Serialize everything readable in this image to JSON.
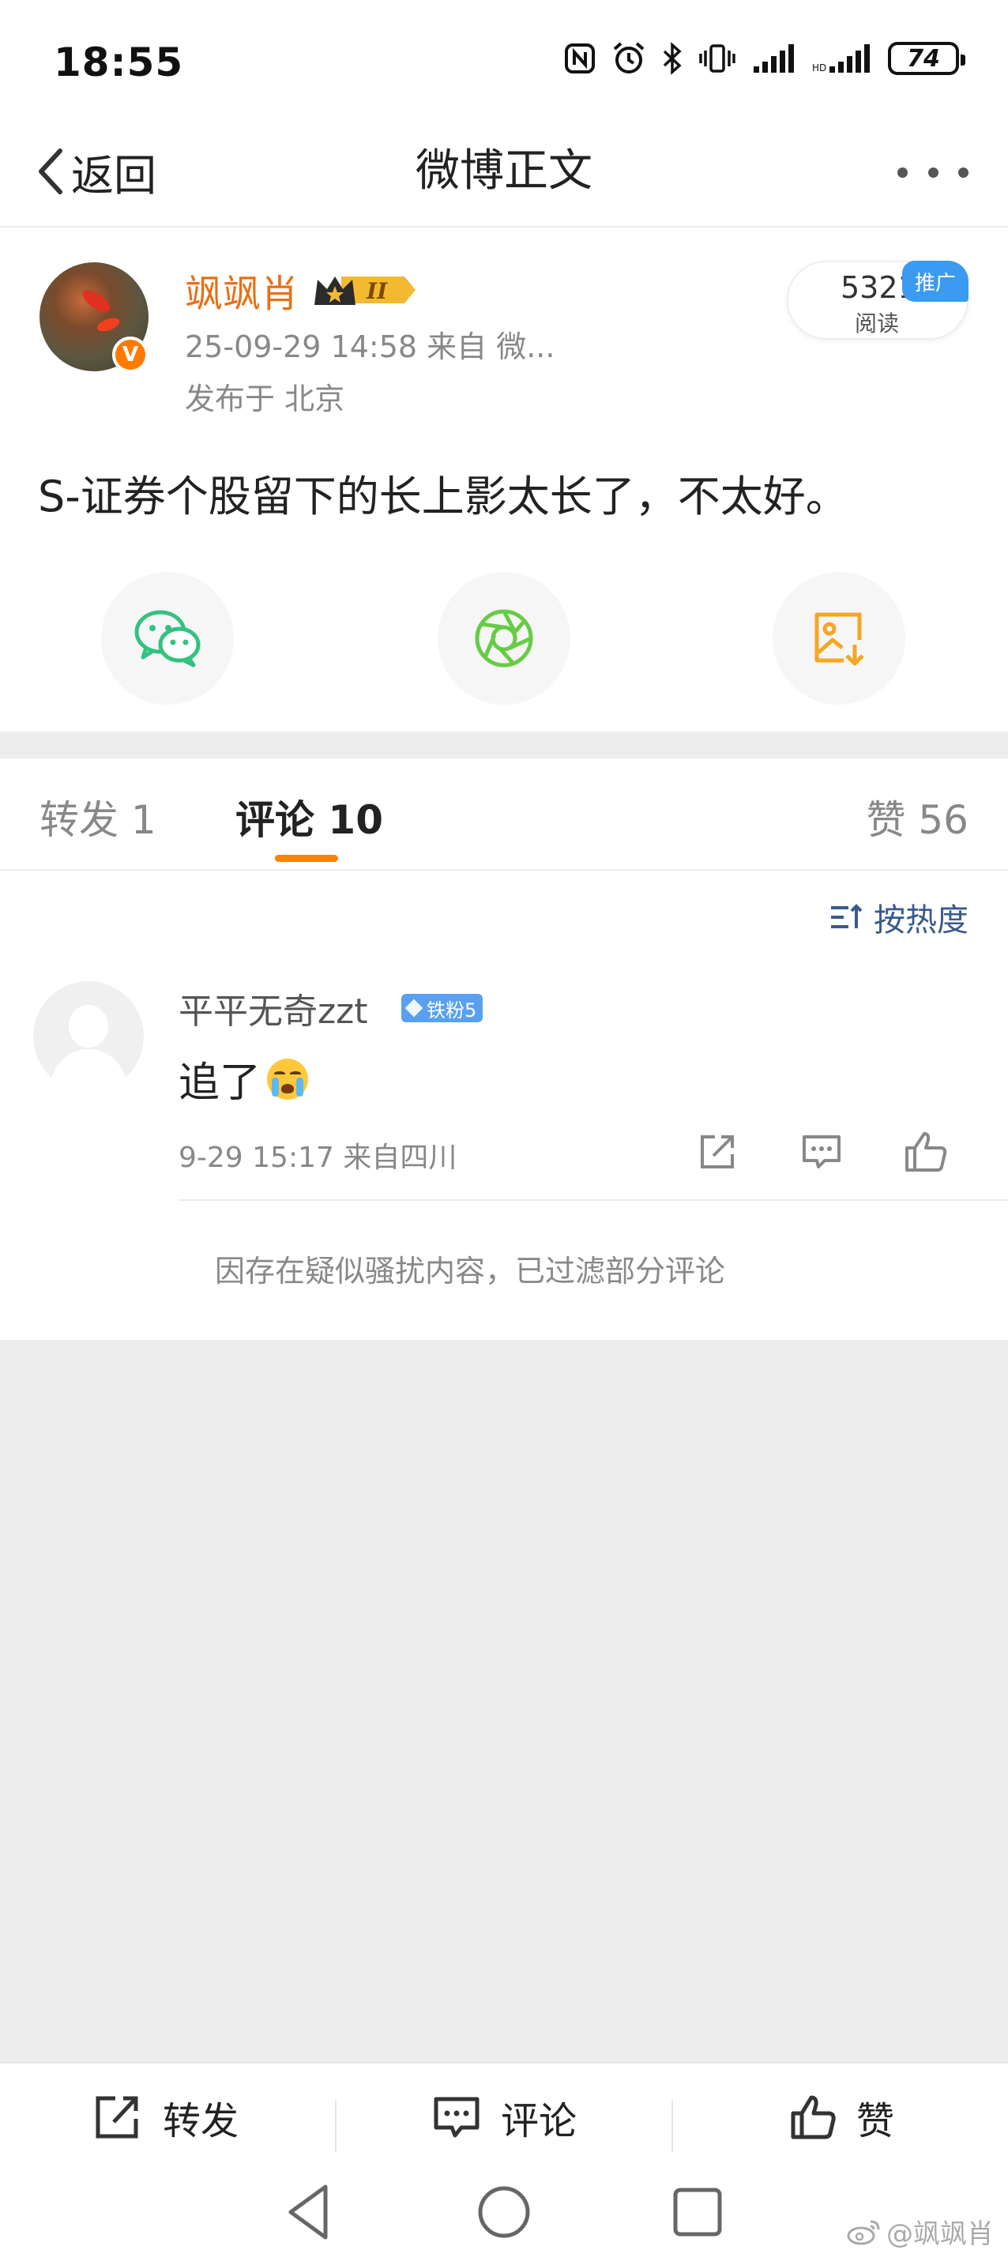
{
  "status_bar": {
    "time": "18:55",
    "battery": "74",
    "icons": [
      "nfc-icon",
      "alarm-icon",
      "bluetooth-icon",
      "vibrate-icon",
      "signal-icon",
      "signal-icon"
    ]
  },
  "nav": {
    "back_label": "返回",
    "title": "微博正文",
    "more_icon": "more-icon"
  },
  "post": {
    "author": "飒飒肖",
    "verified_badge": "V",
    "meta": "25-09-29 14:58  来自 微...",
    "location": "发布于 北京",
    "reads_count": "5321",
    "reads_label": "阅读",
    "promo_tag": "推广",
    "text": "S-证券个股留下的长上影太长了，不太好。",
    "share_buttons": [
      "wechat-icon",
      "moments-icon",
      "save-image-icon"
    ]
  },
  "tabs": {
    "repost": "转发 1",
    "comments": "评论 10",
    "likes": "赞 56"
  },
  "comments": {
    "sort_label": "按热度",
    "items": [
      {
        "user": "平平无奇zzt",
        "fan_badge": "铁粉5",
        "text": "追了",
        "meta": "9-29 15:17 来自四川"
      }
    ],
    "filter_note": "因存在疑似骚扰内容，已过滤部分评论"
  },
  "bottom_bar": {
    "repost": "转发",
    "comment": "评论",
    "like": "赞"
  },
  "watermark": "@飒飒肖",
  "colors": {
    "accent_orange": "#ff8200",
    "author_orange": "#e86f14",
    "promo_blue": "#3a9bf0",
    "wechat_green": "#33c27f",
    "moments_green": "#66cc44",
    "save_orange": "#f5a623"
  }
}
